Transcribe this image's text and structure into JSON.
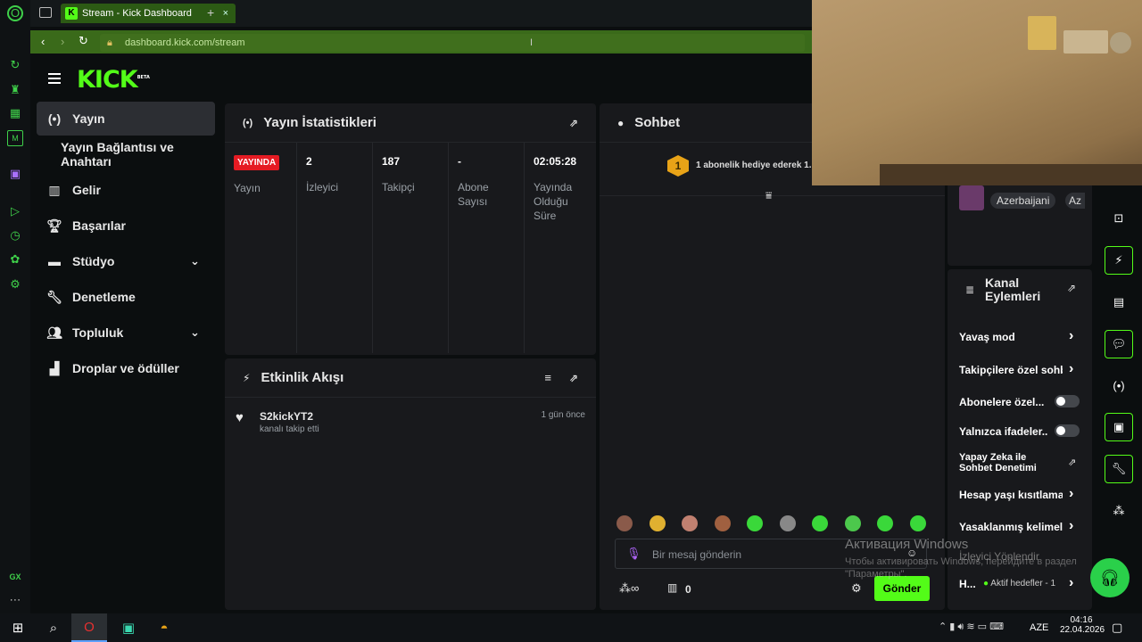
{
  "browser": {
    "tab_title": "Stream - Kick Dashboard",
    "tab_favicon": "K",
    "url": "dashboard.kick.com/stream",
    "accent": "#53fc18"
  },
  "logo": {
    "text": "KICK",
    "tag": "BETA"
  },
  "sidebar": {
    "items": [
      {
        "label": "Yayın",
        "icon": "broadcast-icon"
      },
      {
        "label": "Yayın Bağlantısı ve Anahtarı"
      },
      {
        "label": "Gelir",
        "icon": "chart-icon"
      },
      {
        "label": "Başarılar",
        "icon": "trophy-icon"
      },
      {
        "label": "Stüdyo",
        "icon": "monitor-icon"
      },
      {
        "label": "Denetleme",
        "icon": "wrench-icon"
      },
      {
        "label": "Topluluk",
        "icon": "people-icon"
      },
      {
        "label": "Droplar ve ödüller",
        "icon": "gift-icon"
      }
    ]
  },
  "stats": {
    "title": "Yayın İstatistikleri",
    "live_badge": "YAYINDA",
    "live_label": "Yayın",
    "columns": [
      {
        "value": "2",
        "label": "İzleyici"
      },
      {
        "value": "187",
        "label": "Takipçi"
      },
      {
        "value": "-",
        "label": "Abone Sayısı"
      },
      {
        "value": "02:05:28",
        "label": "Yayında Olduğu Süre"
      }
    ]
  },
  "activity": {
    "title": "Etkinlik Akışı",
    "events": [
      {
        "user": "S2kickYT2",
        "desc": "kanalı takip etti",
        "time": "1 gün önce"
      }
    ]
  },
  "chat": {
    "title": "Sohbet",
    "pinned_rank": "1",
    "pinned_text": "1 abonelik hediye ederek 1.",
    "placeholder": "Bir mesaj gönderin",
    "count": "0",
    "send_label": "Gönder",
    "emote_colors": [
      "#8a5a4a",
      "#e0b030",
      "#c08070",
      "#a06040",
      "#3ad83a",
      "#888",
      "#3ad83a",
      "#4cc84c",
      "#3ad83a",
      "#3ad83a"
    ]
  },
  "channel_tags": [
    "Azerbaijani",
    "Az"
  ],
  "channel_actions": {
    "title": "Kanal Eylemleri",
    "items": [
      {
        "label": "Yavaş mod",
        "control": "chevron"
      },
      {
        "label": "Takipçilere özel sohbet",
        "control": "chevron"
      },
      {
        "label": "Abonelere özel...",
        "control": "toggle",
        "on": false
      },
      {
        "label": "Yalnızca ifadeler...",
        "control": "toggle",
        "on": false
      },
      {
        "label": "Yapay Zeka ile Sohbet Denetimi",
        "control": "external"
      },
      {
        "label": "Hesap yaşı kısıtlama",
        "control": "chevron"
      },
      {
        "label": "Yasaklanmış kelimeler",
        "control": "chevron"
      },
      {
        "label": "İzleyici Yönlendir",
        "control": "chevron"
      },
      {
        "label": "H...",
        "control": "chevron",
        "badge": "Aktif hedefler - 1"
      }
    ]
  },
  "watermark": {
    "title": "Активация Windows",
    "line1": "Чтобы активировать Windows, перейдите в раздел",
    "line2": "\"Параметры\"."
  },
  "taskbar": {
    "language": "AZE",
    "time": "04:16",
    "date": "22.04.2026"
  },
  "gx_label": "GX"
}
